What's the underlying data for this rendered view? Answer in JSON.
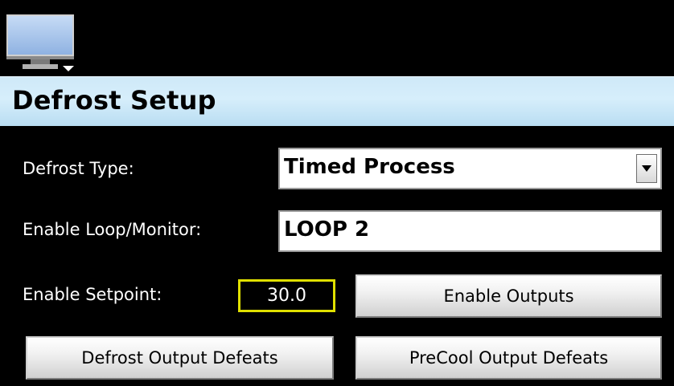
{
  "header": {
    "monitor_icon": "monitor-icon",
    "title": "Defrost Setup",
    "colors": {
      "title_bar": "#cfe9f8",
      "background": "#000000",
      "setpoint_border": "#e0e000"
    }
  },
  "form": {
    "defrost_type_label": "Defrost Type:",
    "defrost_type_value": "Timed Process",
    "enable_loop_label": "Enable Loop/Monitor:",
    "enable_loop_value": "LOOP 2",
    "enable_setpoint_label": "Enable Setpoint:",
    "enable_setpoint_value": "30.0"
  },
  "buttons": {
    "enable_outputs": "Enable Outputs",
    "defrost_output_defeats": "Defrost Output Defeats",
    "precool_output_defeats": "PreCool Output Defeats"
  }
}
